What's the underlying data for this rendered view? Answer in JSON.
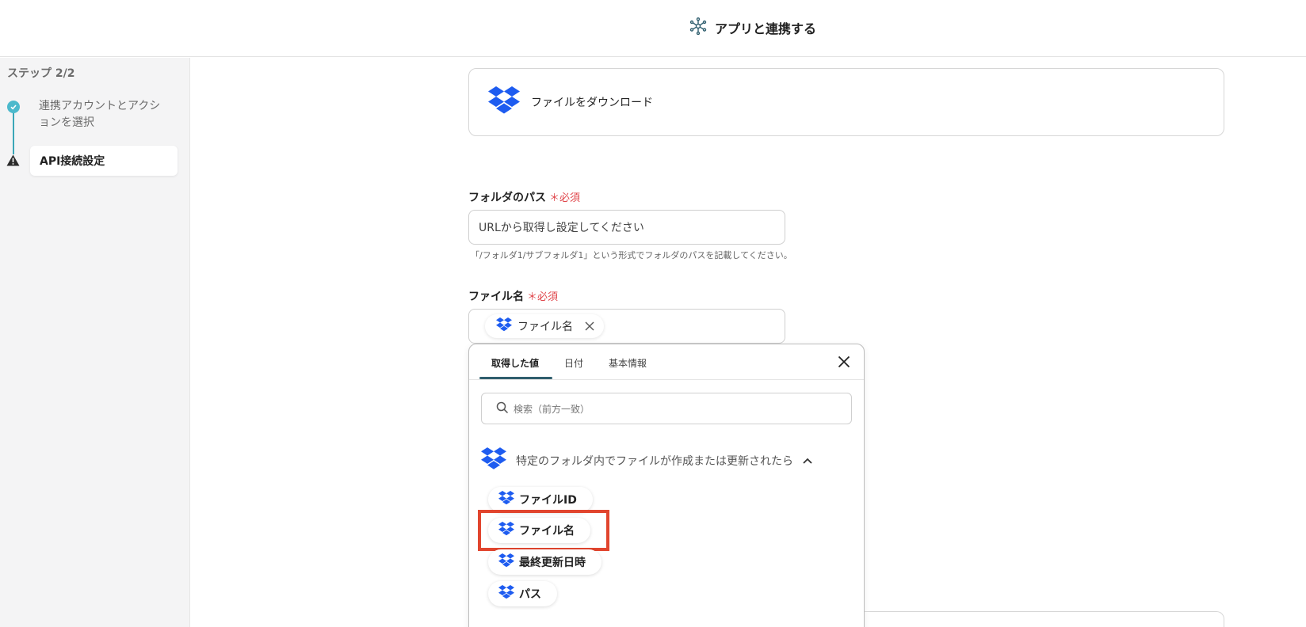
{
  "header": {
    "title": "アプリと連携する",
    "icon": "network-icon"
  },
  "sidebar": {
    "step_count": "ステップ 2/2",
    "steps": [
      {
        "label": "連携アカウントとアクションを選択",
        "status": "done"
      },
      {
        "label": "API接続設定",
        "status": "warning"
      }
    ]
  },
  "action": {
    "label": "ファイルをダウンロード",
    "icon": "dropbox-icon"
  },
  "fields": {
    "folder_path": {
      "label": "フォルダのパス",
      "required": "必須",
      "placeholder": "URLから取得し設定してください",
      "hint": "「/フォルダ1/サブフォルダ1」という形式でフォルダのパスを記載してください。"
    },
    "file_name": {
      "label": "ファイル名",
      "required": "必須",
      "chip_label": "ファイル名"
    }
  },
  "panel": {
    "tabs": [
      "取得した値",
      "日付",
      "基本情報"
    ],
    "active_tab": 0,
    "search_placeholder": "検索（前方一致）",
    "group_title": "特定のフォルダ内でファイルが作成または更新されたら",
    "items": [
      "ファイルID",
      "ファイル名",
      "最終更新日時",
      "パス"
    ],
    "highlighted_item": "ファイル名"
  },
  "colors": {
    "accent": "#3aa7b8",
    "required": "#e0474c",
    "highlight": "#e1452e",
    "dropbox": "#1e5cf0"
  }
}
